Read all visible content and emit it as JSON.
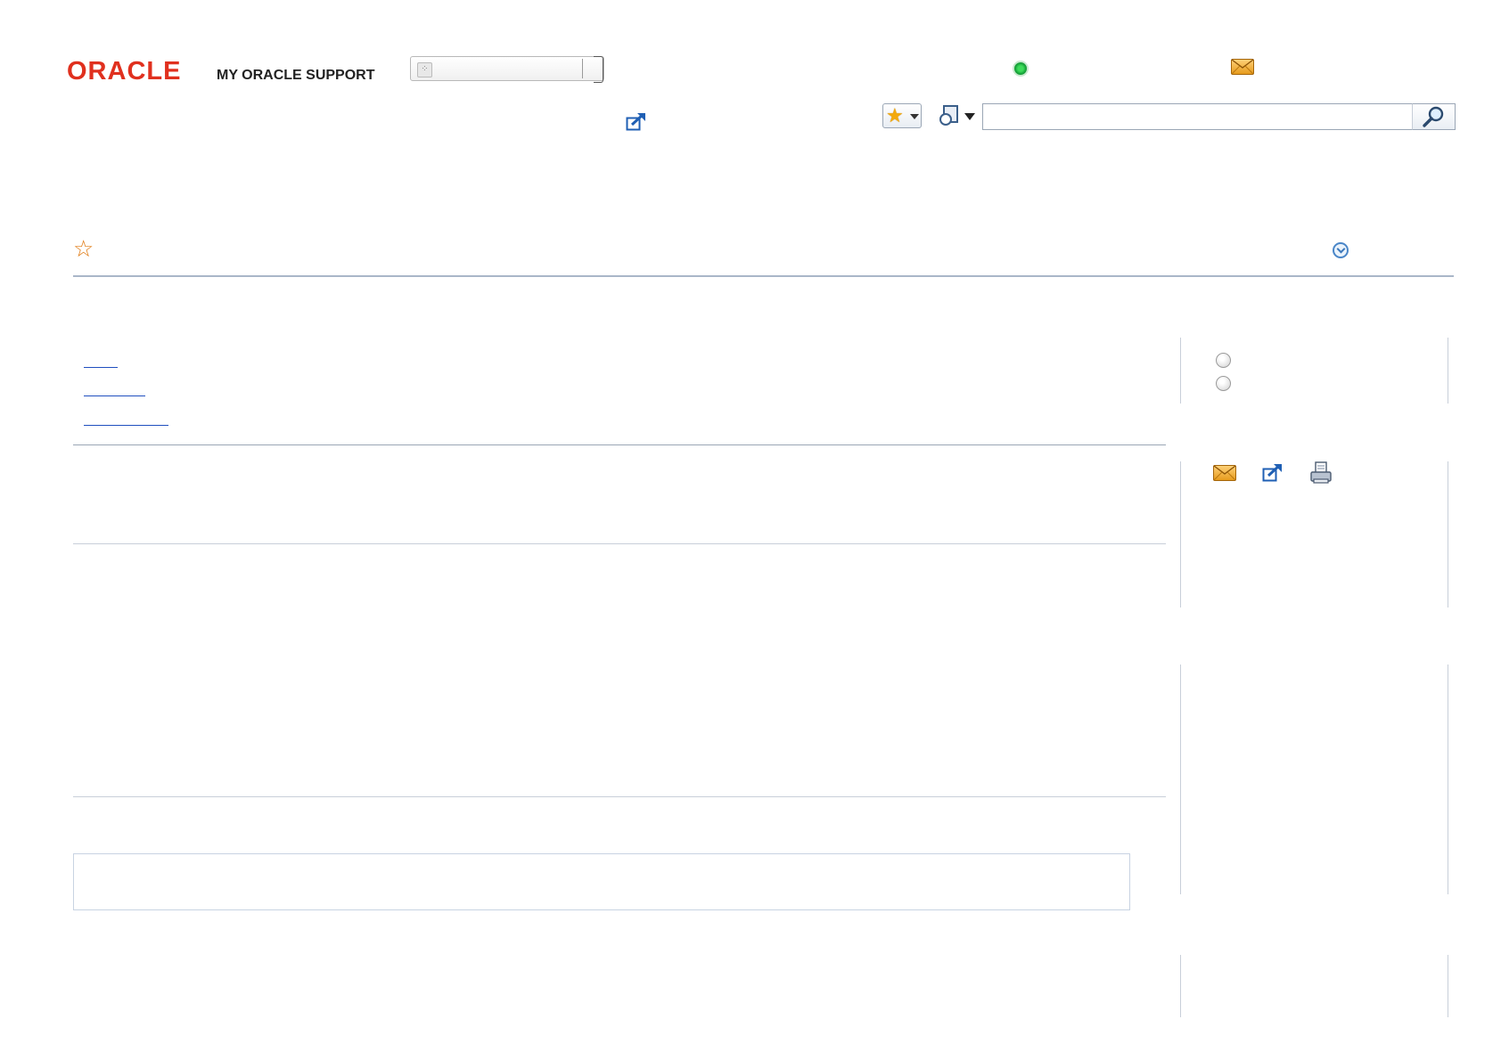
{
  "header": {
    "logo_text": "ORACLE",
    "logo_subtitle": "MY ORACLE SUPPORT",
    "selector_icon": "grid-icon",
    "status_icon": "status-online-icon",
    "status_color": "#17a43a",
    "messages_icon": "mail-icon",
    "popout_icon": "external-link-icon",
    "favorites_icon": "star-icon",
    "recent_icon": "recent-pages-icon",
    "search": {
      "value": "",
      "placeholder": ""
    },
    "search_icon": "magnifier-icon"
  },
  "page": {
    "favorite_icon": "star-outline-icon",
    "expand_icon": "expand-down-icon",
    "accent_color": "#e07a12"
  },
  "left": {
    "links": [
      "",
      "",
      ""
    ]
  },
  "right": {
    "radios": [
      "",
      ""
    ],
    "action_icons": [
      "mail-icon",
      "external-link-icon",
      "print-icon"
    ]
  }
}
